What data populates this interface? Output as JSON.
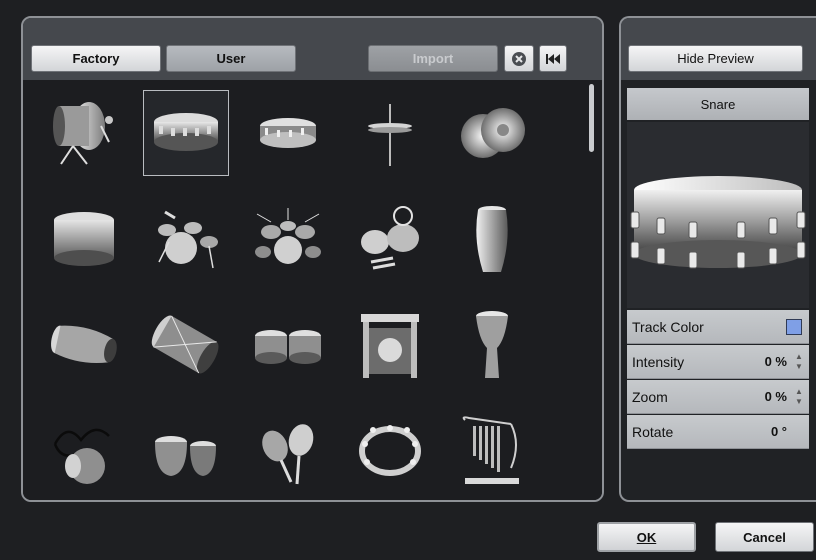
{
  "toolbar": {
    "factory_label": "Factory",
    "user_label": "User",
    "import_label": "Import",
    "clear_icon": "x-circle-icon",
    "reset_icon": "skip-to-start-icon"
  },
  "icon_grid": {
    "selected_index": 1,
    "items": [
      "bass-drum-on-stand-icon",
      "snare-drum-icon",
      "piccolo-snare-icon",
      "hi-hat-icon",
      "cymbals-icon",
      "floor-tom-icon",
      "drum-kit-small-icon",
      "drum-kit-large-icon",
      "percussion-set-icon",
      "conga-icon",
      "mridangam-icon",
      "dhol-icon",
      "bongos-icon",
      "gong-icon",
      "djembe-icon",
      "udu-icon",
      "tabla-icon",
      "maracas-icon",
      "tambourine-icon",
      "chimes-icon"
    ]
  },
  "preview": {
    "hide_label": "Hide Preview",
    "title": "Snare",
    "image_icon": "snare-drum-icon",
    "properties": {
      "track_color_label": "Track Color",
      "track_color": "#7f9fe6",
      "intensity_label": "Intensity",
      "intensity_value": "0 %",
      "zoom_label": "Zoom",
      "zoom_value": "0 %",
      "rotate_label": "Rotate",
      "rotate_value": "0 °"
    }
  },
  "dialog": {
    "ok_label": "OK",
    "cancel_label": "Cancel"
  }
}
